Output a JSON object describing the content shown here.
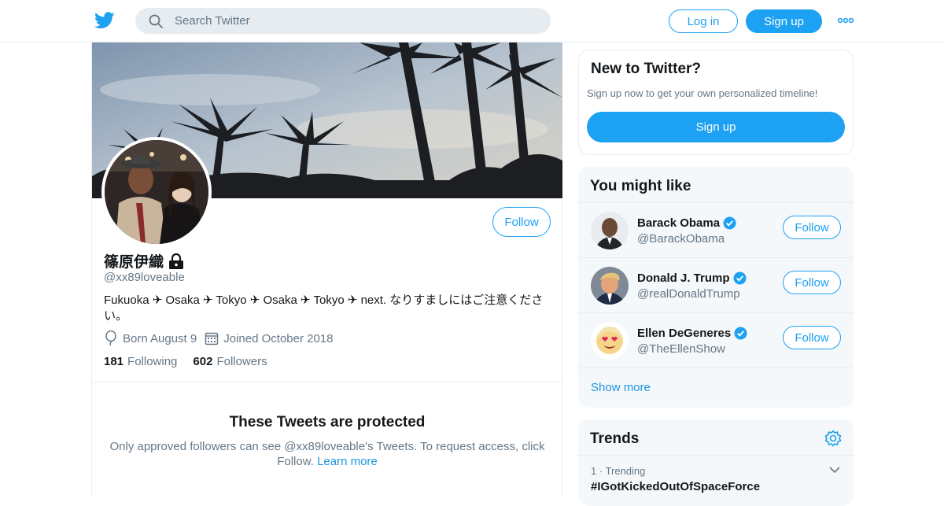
{
  "header": {
    "search_placeholder": "Search Twitter",
    "login_label": "Log in",
    "signup_label": "Sign up"
  },
  "profile": {
    "name": "篠原伊織",
    "handle": "@xx89loveable",
    "bio": "Fukuoka ✈ Osaka ✈ Tokyo ✈ Osaka ✈ Tokyo ✈ next. なりすましにはご注意ください。",
    "born": "Born August 9",
    "joined": "Joined October 2018",
    "following_count": "181",
    "following_label": "Following",
    "followers_count": "602",
    "followers_label": "Followers",
    "follow_label": "Follow",
    "protected_title": "These Tweets are protected",
    "protected_text": "Only approved followers can see @xx89loveable’s Tweets. To request access, click Follow.",
    "learn_more": "Learn more"
  },
  "new_to_twitter": {
    "title": "New to Twitter?",
    "subtitle": "Sign up now to get your own personalized timeline!",
    "signup_label": "Sign up"
  },
  "you_might_like": {
    "title": "You might like",
    "accounts": [
      {
        "name": "Barack Obama",
        "handle": "@BarackObama",
        "follow_label": "Follow"
      },
      {
        "name": "Donald J. Trump",
        "handle": "@realDonaldTrump",
        "follow_label": "Follow"
      },
      {
        "name": "Ellen DeGeneres",
        "handle": "@TheEllenShow",
        "follow_label": "Follow"
      }
    ],
    "show_more": "Show more"
  },
  "trends": {
    "title": "Trends",
    "items": [
      {
        "meta": "1 · Trending",
        "name": "#IGotKickedOutOfSpaceForce"
      }
    ]
  },
  "colors": {
    "accent": "#1da1f2",
    "link": "#1b95e0",
    "secondary_text": "#657786",
    "panel_bg": "#f5f8fa",
    "border": "#e6ecf0"
  },
  "icons": [
    "twitter-bird-icon",
    "search-icon",
    "more-dots-icon",
    "lock-icon",
    "balloon-icon",
    "calendar-icon",
    "verified-icon",
    "gear-icon",
    "chevron-down-icon"
  ]
}
